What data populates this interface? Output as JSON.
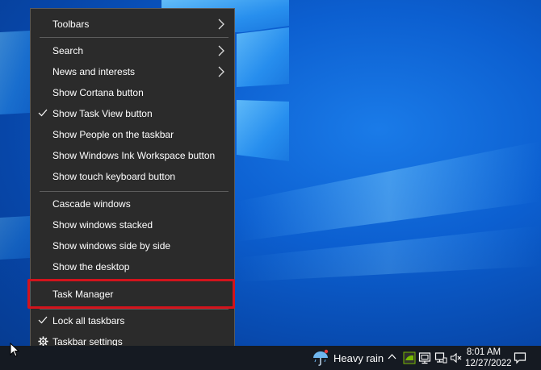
{
  "context_menu": {
    "items": [
      {
        "label": "Toolbars",
        "submenu": true,
        "checked": false
      },
      {
        "label": "Search",
        "submenu": true,
        "checked": false
      },
      {
        "label": "News and interests",
        "submenu": true,
        "checked": false
      },
      {
        "label": "Show Cortana button",
        "submenu": false,
        "checked": false
      },
      {
        "label": "Show Task View button",
        "submenu": false,
        "checked": true
      },
      {
        "label": "Show People on the taskbar",
        "submenu": false,
        "checked": false
      },
      {
        "label": "Show Windows Ink Workspace button",
        "submenu": false,
        "checked": false
      },
      {
        "label": "Show touch keyboard button",
        "submenu": false,
        "checked": false
      },
      {
        "label": "Cascade windows",
        "submenu": false,
        "checked": false
      },
      {
        "label": "Show windows stacked",
        "submenu": false,
        "checked": false
      },
      {
        "label": "Show windows side by side",
        "submenu": false,
        "checked": false
      },
      {
        "label": "Show the desktop",
        "submenu": false,
        "checked": false
      },
      {
        "label": "Task Manager",
        "submenu": false,
        "checked": false,
        "highlighted": true
      },
      {
        "label": "Lock all taskbars",
        "submenu": false,
        "checked": true
      },
      {
        "label": "Taskbar settings",
        "submenu": false,
        "checked": false,
        "icon": "gear-icon"
      }
    ]
  },
  "taskbar": {
    "weather": {
      "icon": "rain-umbrella-icon",
      "text": "Heavy rain"
    },
    "tray_icons": [
      "chevron-up-icon",
      "nvidia-icon",
      "display-icon",
      "network-icon",
      "volume-muted-icon"
    ],
    "time": "8:01 AM",
    "date": "12/27/2022",
    "notification_icon": "notification-icon"
  },
  "colors": {
    "menu_bg": "#2b2b2b",
    "highlight_border": "#d3131c",
    "taskbar_bg": "#151a22",
    "desktop_blue": "#0c5fd0"
  }
}
